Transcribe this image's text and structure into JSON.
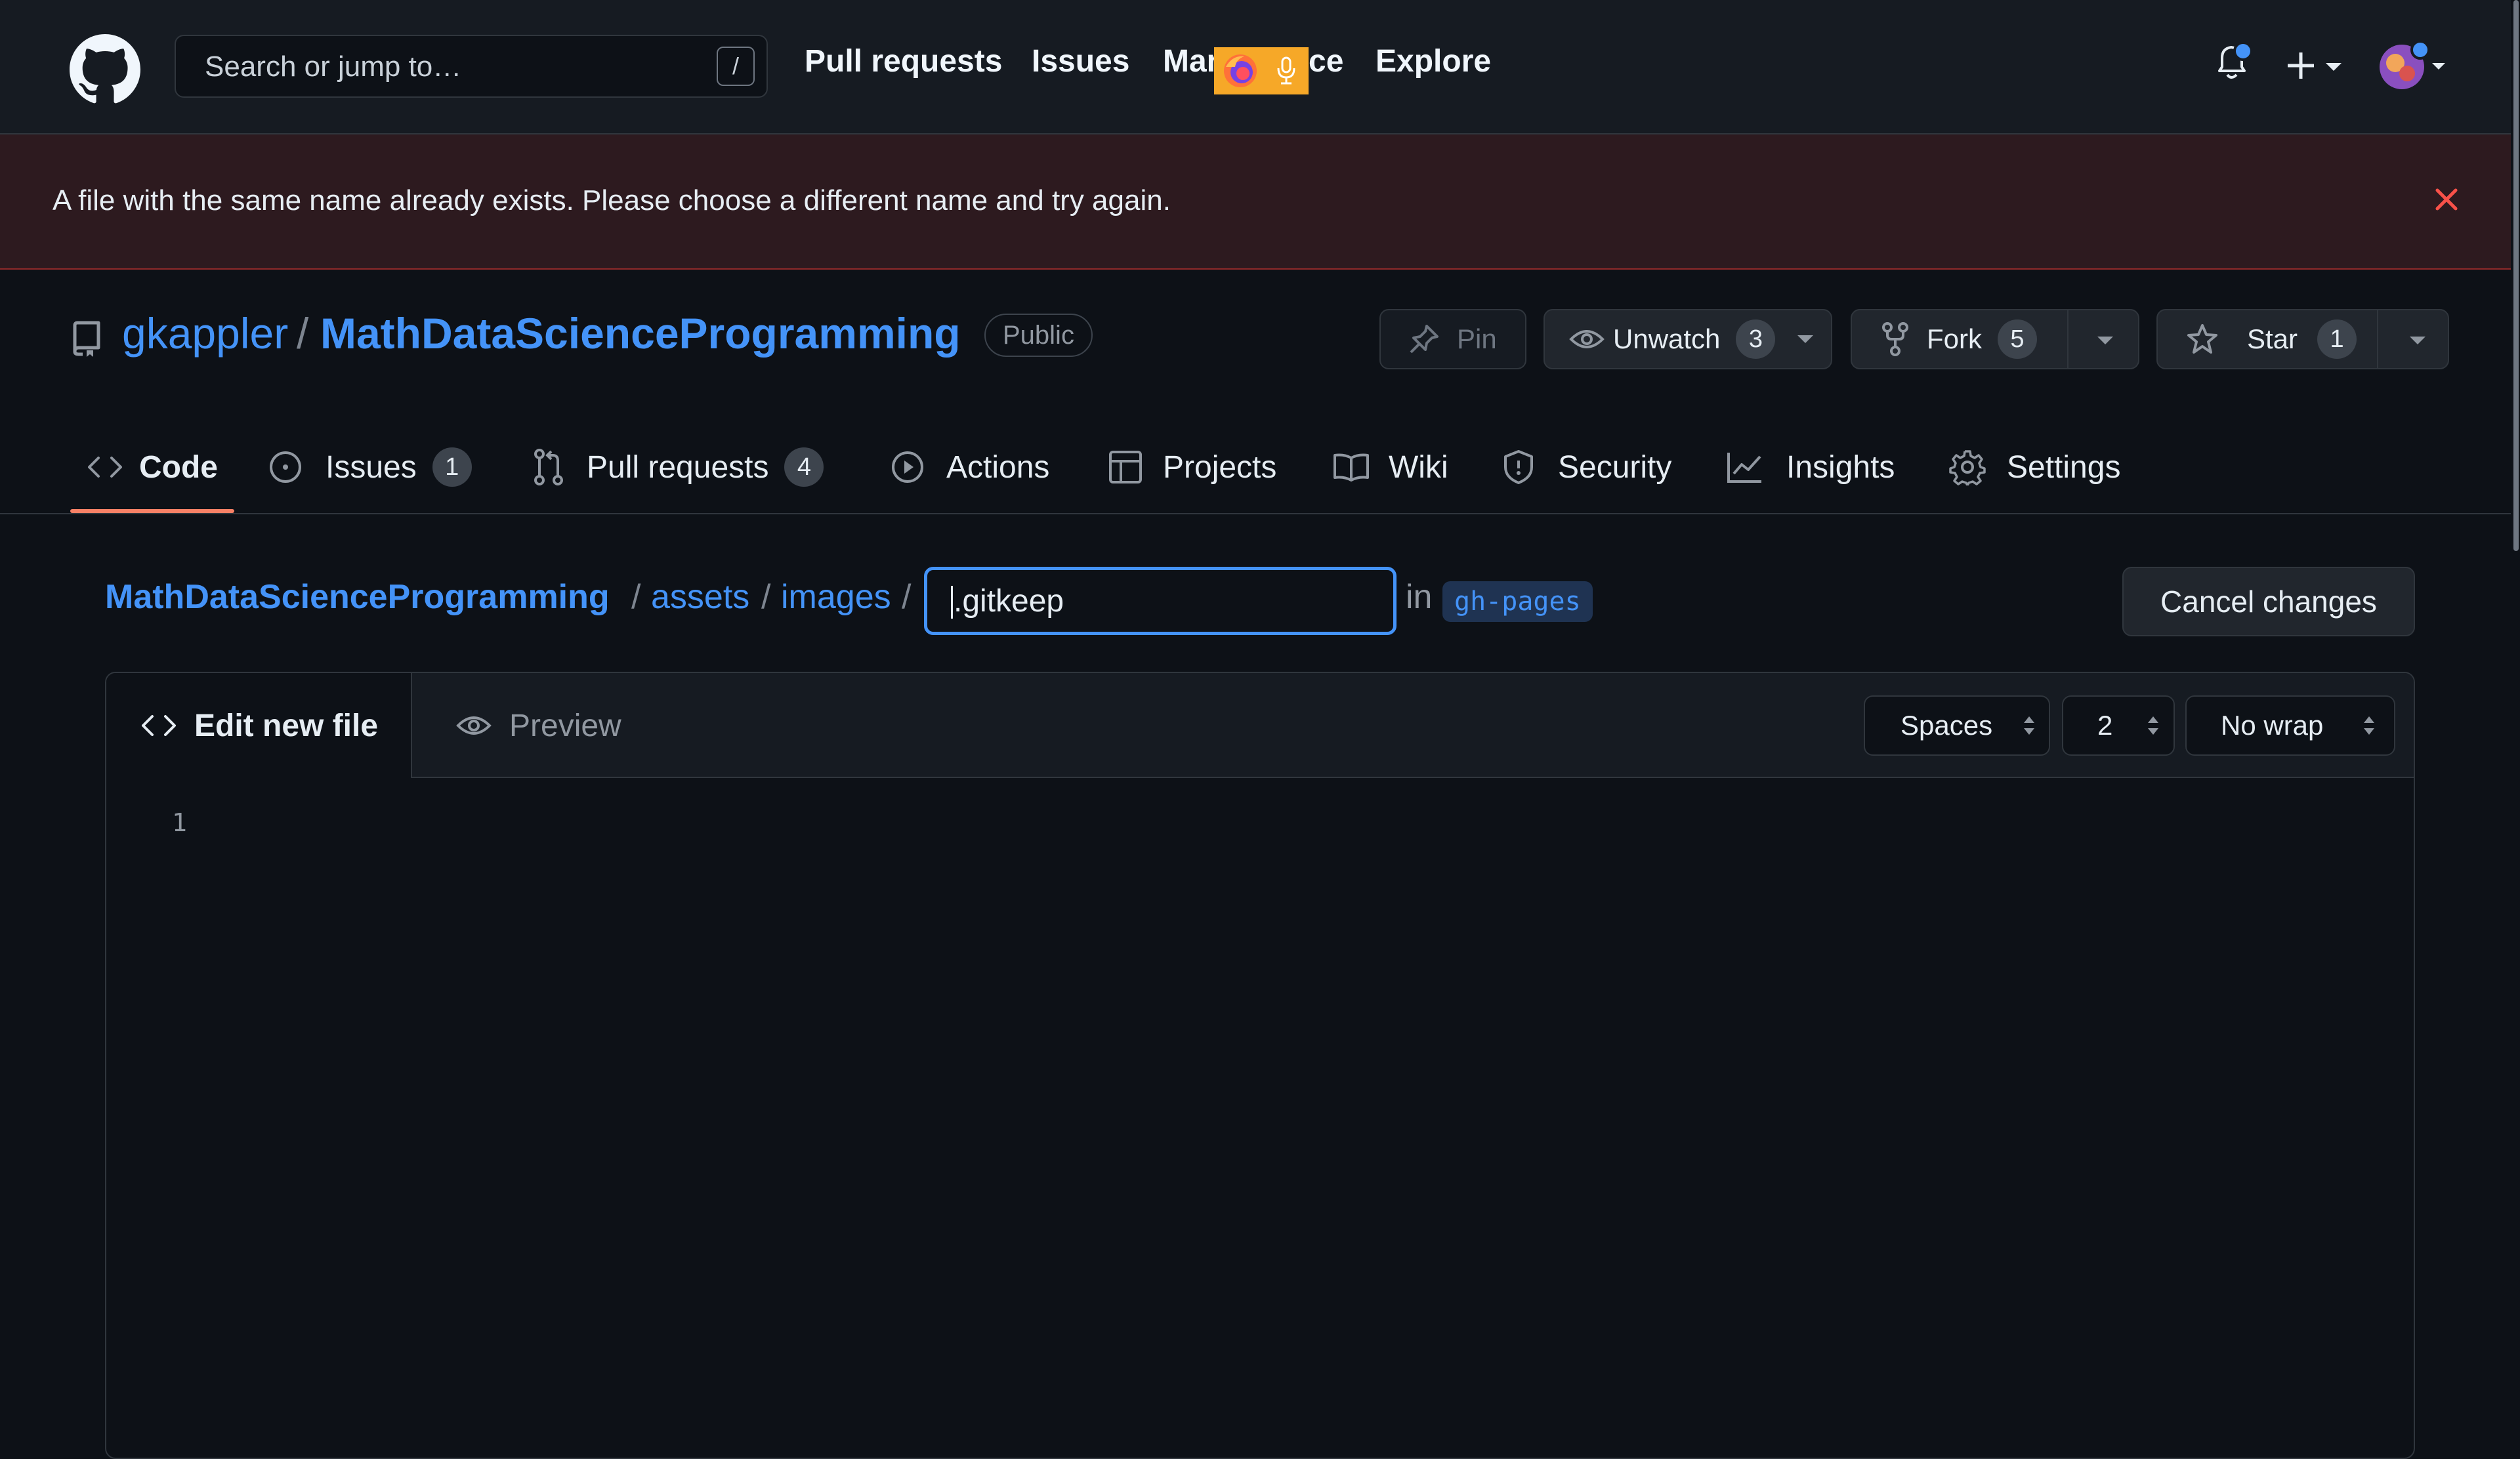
{
  "header": {
    "search_placeholder": "Search or jump to…",
    "search_shortcut": "/",
    "nav": {
      "pull_requests": "Pull requests",
      "issues": "Issues",
      "marketplace_left": "Mar",
      "marketplace_right": "ce",
      "explore": "Explore"
    }
  },
  "banner": {
    "message": "A file with the same name already exists. Please choose a different name and try again."
  },
  "repo": {
    "owner": "gkappler",
    "separator": "/",
    "name": "MathDataScienceProgramming",
    "visibility": "Public",
    "actions": {
      "pin": "Pin",
      "unwatch": "Unwatch",
      "watch_count": "3",
      "fork": "Fork",
      "fork_count": "5",
      "star": "Star",
      "star_count": "1"
    },
    "tabs": [
      {
        "label": "Code"
      },
      {
        "label": "Issues",
        "count": "1"
      },
      {
        "label": "Pull requests",
        "count": "4"
      },
      {
        "label": "Actions"
      },
      {
        "label": "Projects"
      },
      {
        "label": "Wiki"
      },
      {
        "label": "Security"
      },
      {
        "label": "Insights"
      },
      {
        "label": "Settings"
      }
    ]
  },
  "editor": {
    "breadcrumb": [
      "MathDataScienceProgramming",
      "assets",
      "images"
    ],
    "crumb_separator": "/",
    "filename": ".gitkeep",
    "in_label": "in",
    "branch": "gh-pages",
    "cancel_label": "Cancel changes",
    "tab_edit": "Edit new file",
    "tab_preview": "Preview",
    "indent_mode": "Spaces",
    "indent_size": "2",
    "wrap_mode": "No wrap",
    "line_numbers": [
      "1"
    ]
  },
  "colors": {
    "accent": "#4493f8",
    "danger": "#f85149",
    "background": "#0d1117",
    "tab_underline": "#f78166",
    "extension_badge": "#f6a828"
  }
}
